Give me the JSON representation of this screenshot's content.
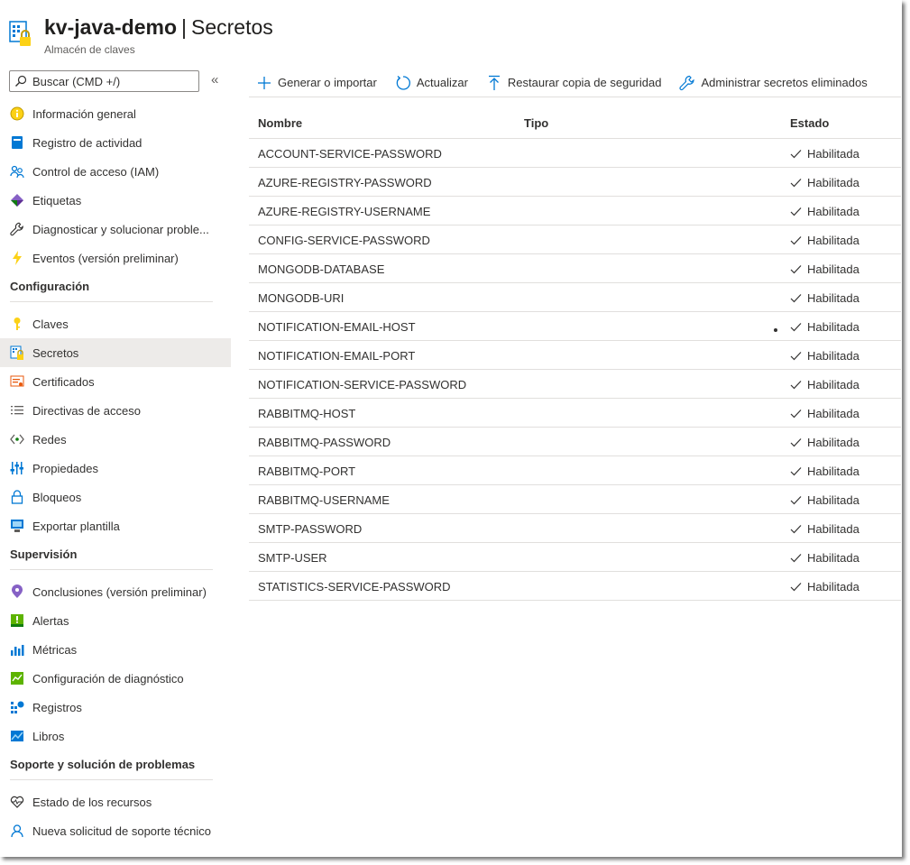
{
  "header": {
    "resource_name": "kv-java-demo",
    "separator": "|",
    "page_name": "Secretos",
    "subtitle": "Almacén de claves"
  },
  "sidebar": {
    "search_placeholder": "Buscar (CMD +/)",
    "collapse_glyph": "«",
    "groups": [
      {
        "items": [
          {
            "label": "Información general",
            "icon": "overview-icon"
          },
          {
            "label": "Registro de actividad",
            "icon": "activity-log-icon"
          },
          {
            "label": "Control de acceso (IAM)",
            "icon": "iam-icon"
          },
          {
            "label": "Etiquetas",
            "icon": "tag-icon"
          },
          {
            "label": "Diagnosticar y solucionar proble...",
            "icon": "wrench-icon"
          },
          {
            "label": "Eventos (versión preliminar)",
            "icon": "lightning-icon"
          }
        ]
      },
      {
        "title": "Configuración",
        "items": [
          {
            "label": "Claves",
            "icon": "key-icon"
          },
          {
            "label": "Secretos",
            "icon": "secret-icon",
            "active": true
          },
          {
            "label": "Certificados",
            "icon": "certificate-icon"
          },
          {
            "label": "Directivas de acceso",
            "icon": "list-icon"
          },
          {
            "label": "Redes",
            "icon": "network-icon"
          },
          {
            "label": "Propiedades",
            "icon": "properties-icon"
          },
          {
            "label": "Bloqueos",
            "icon": "lock-icon"
          },
          {
            "label": "Exportar plantilla",
            "icon": "export-template-icon"
          }
        ]
      },
      {
        "title": "Supervisión",
        "items": [
          {
            "label": "Conclusiones (versión preliminar)",
            "icon": "insights-icon"
          },
          {
            "label": "Alertas",
            "icon": "alerts-icon"
          },
          {
            "label": "Métricas",
            "icon": "metrics-icon"
          },
          {
            "label": "Configuración de diagnóstico",
            "icon": "diagnostic-settings-icon"
          },
          {
            "label": "Registros",
            "icon": "logs-icon"
          },
          {
            "label": "Libros",
            "icon": "workbooks-icon"
          }
        ]
      },
      {
        "title": "Soporte y solución de problemas",
        "items": [
          {
            "label": "Estado de los recursos",
            "icon": "heart-icon"
          },
          {
            "label": "Nueva solicitud de soporte técnico",
            "icon": "support-icon"
          }
        ]
      }
    ]
  },
  "toolbar": {
    "generate_label": "Generar o importar",
    "refresh_label": "Actualizar",
    "restore_label": "Restaurar copia de seguridad",
    "manage_deleted_label": "Administrar secretos eliminados"
  },
  "table": {
    "columns": {
      "name": "Nombre",
      "type": "Tipo",
      "status": "Estado"
    },
    "rows": [
      {
        "name": "ACCOUNT-SERVICE-PASSWORD",
        "type": "",
        "status": "Habilitada"
      },
      {
        "name": "AZURE-REGISTRY-PASSWORD",
        "type": "",
        "status": "Habilitada"
      },
      {
        "name": "AZURE-REGISTRY-USERNAME",
        "type": "",
        "status": "Habilitada"
      },
      {
        "name": "CONFIG-SERVICE-PASSWORD",
        "type": "",
        "status": "Habilitada"
      },
      {
        "name": "MONGODB-DATABASE",
        "type": "",
        "status": "Habilitada"
      },
      {
        "name": "MONGODB-URI",
        "type": "",
        "status": "Habilitada"
      },
      {
        "name": "NOTIFICATION-EMAIL-HOST",
        "type": "",
        "status": "Habilitada"
      },
      {
        "name": "NOTIFICATION-EMAIL-PORT",
        "type": "",
        "status": "Habilitada"
      },
      {
        "name": "NOTIFICATION-SERVICE-PASSWORD",
        "type": "",
        "status": "Habilitada"
      },
      {
        "name": "RABBITMQ-HOST",
        "type": "",
        "status": "Habilitada"
      },
      {
        "name": "RABBITMQ-PASSWORD",
        "type": "",
        "status": "Habilitada"
      },
      {
        "name": "RABBITMQ-PORT",
        "type": "",
        "status": "Habilitada"
      },
      {
        "name": "RABBITMQ-USERNAME",
        "type": "",
        "status": "Habilitada"
      },
      {
        "name": "SMTP-PASSWORD",
        "type": "",
        "status": "Habilitada"
      },
      {
        "name": "SMTP-USER",
        "type": "",
        "status": "Habilitada"
      },
      {
        "name": "STATISTICS-SERVICE-PASSWORD",
        "type": "",
        "status": "Habilitada"
      }
    ]
  },
  "colors": {
    "accent": "#0078d4",
    "active_bg": "#edebe9",
    "divider": "#e1dfdd",
    "text": "#323130"
  }
}
